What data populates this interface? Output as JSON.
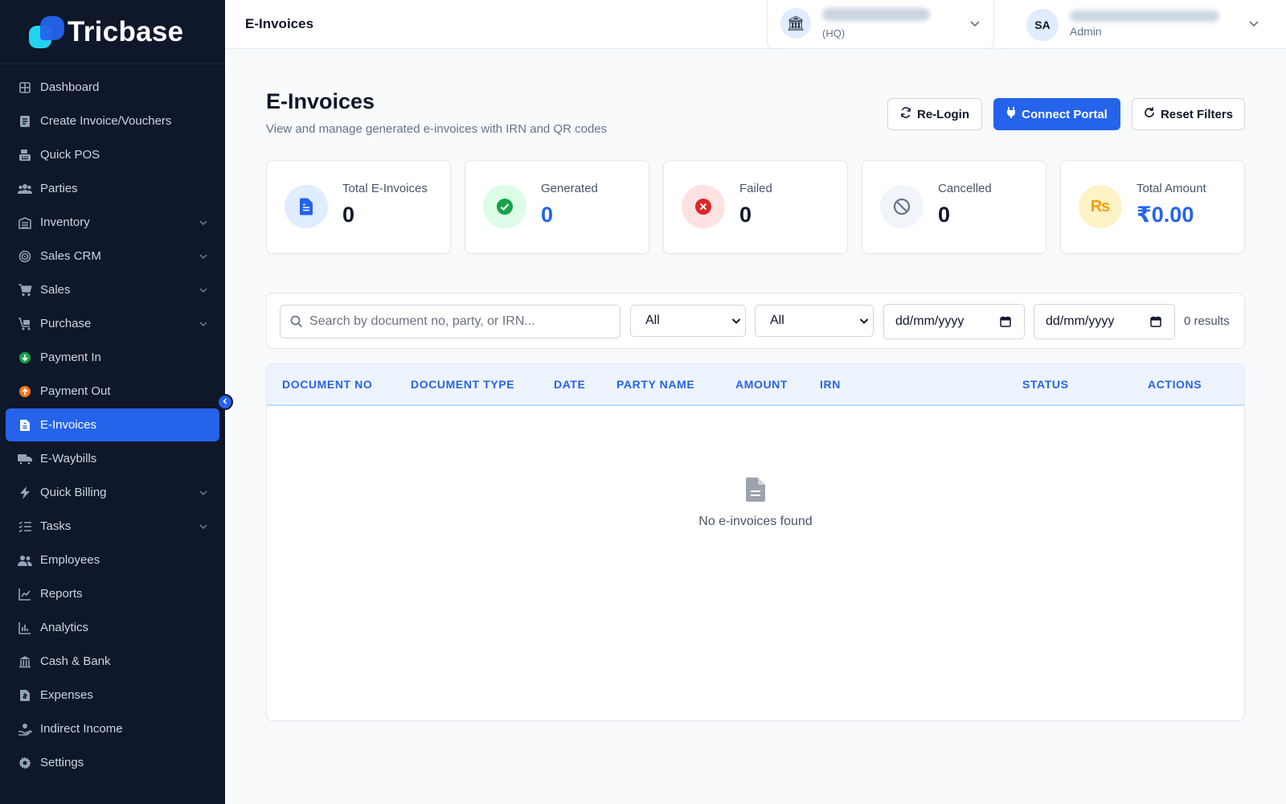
{
  "brand": {
    "name": "Tricbase"
  },
  "sidebar": {
    "items": [
      {
        "label": "Dashboard",
        "icon": "dashboard-icon"
      },
      {
        "label": "Create Invoice/Vouchers",
        "icon": "invoice-icon"
      },
      {
        "label": "Quick POS",
        "icon": "pos-icon"
      },
      {
        "label": "Parties",
        "icon": "parties-icon"
      },
      {
        "label": "Inventory",
        "icon": "inventory-icon",
        "expandable": true
      },
      {
        "label": "Sales CRM",
        "icon": "crm-icon",
        "expandable": true
      },
      {
        "label": "Sales",
        "icon": "cart-icon",
        "expandable": true
      },
      {
        "label": "Purchase",
        "icon": "purchase-icon",
        "expandable": true
      },
      {
        "label": "Payment In",
        "icon": "payment-in-icon"
      },
      {
        "label": "Payment Out",
        "icon": "payment-out-icon"
      },
      {
        "label": "E-Invoices",
        "icon": "e-invoice-icon",
        "active": true
      },
      {
        "label": "E-Waybills",
        "icon": "truck-icon"
      },
      {
        "label": "Quick Billing",
        "icon": "bolt-icon",
        "expandable": true
      },
      {
        "label": "Tasks",
        "icon": "tasks-icon",
        "expandable": true
      },
      {
        "label": "Employees",
        "icon": "employees-icon"
      },
      {
        "label": "Reports",
        "icon": "reports-icon"
      },
      {
        "label": "Analytics",
        "icon": "analytics-icon"
      },
      {
        "label": "Cash & Bank",
        "icon": "bank-icon"
      },
      {
        "label": "Expenses",
        "icon": "expenses-icon"
      },
      {
        "label": "Indirect Income",
        "icon": "income-icon"
      },
      {
        "label": "Settings",
        "icon": "gear-icon"
      }
    ]
  },
  "topbar": {
    "title": "E-Invoices",
    "branch": {
      "sub": "(HQ)",
      "icon": "bank-building-icon"
    },
    "user": {
      "initials": "SA",
      "role": "Admin"
    }
  },
  "page": {
    "title": "E-Invoices",
    "subtitle": "View and manage generated e-invoices with IRN and QR codes",
    "buttons": {
      "relogin": "Re-Login",
      "connect": "Connect Portal",
      "reset": "Reset Filters"
    }
  },
  "stats": [
    {
      "label": "Total E-Invoices",
      "value": "0",
      "icon": "document-icon",
      "color": "#2563eb",
      "bg": "#e0ecff"
    },
    {
      "label": "Generated",
      "value": "0",
      "icon": "check-circle-icon",
      "color": "#16a34a",
      "bg": "#dcfce7"
    },
    {
      "label": "Failed",
      "value": "0",
      "icon": "x-circle-icon",
      "color": "#dc2626",
      "bg": "#fee2e2"
    },
    {
      "label": "Cancelled",
      "value": "0",
      "icon": "ban-icon",
      "color": "#64748b",
      "bg": "#f1f5f9"
    },
    {
      "label": "Total Amount",
      "value": "₹0.00",
      "icon": "rupee-icon",
      "color": "#f59e0b",
      "bg": "#fef3c7"
    }
  ],
  "filters": {
    "search_placeholder": "Search by document no, party, or IRN...",
    "select1": "All",
    "select2": "All",
    "date_from": "dd/mm/yyyy",
    "date_to": "dd/mm/yyyy",
    "results": "0 results"
  },
  "table": {
    "columns": [
      "DOCUMENT NO",
      "DOCUMENT TYPE",
      "DATE",
      "PARTY NAME",
      "AMOUNT",
      "IRN",
      "STATUS",
      "ACTIONS"
    ],
    "empty_text": "No e-invoices found"
  },
  "colors": {
    "sidebar_bg": "#0f172a",
    "accent": "#2563eb"
  }
}
